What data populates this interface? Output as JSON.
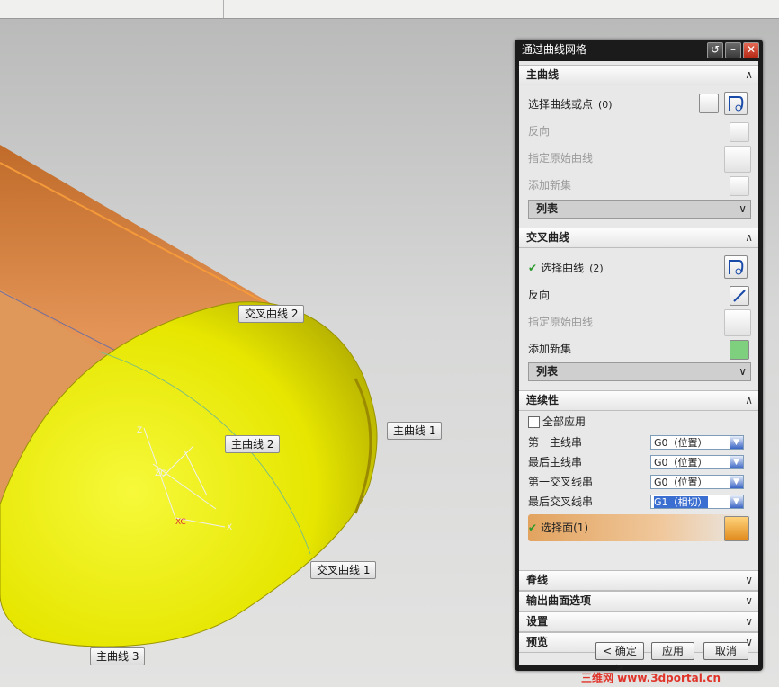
{
  "viewport": {
    "callouts": {
      "cross2": "交叉曲线 2",
      "primary1": "主曲线 1",
      "primary2": "主曲线 2",
      "cross1": "交叉曲线 1",
      "primary3": "主曲线 3"
    },
    "axes": {
      "zc": "ZC",
      "z": "Z",
      "xc": "XC",
      "x": "X"
    }
  },
  "dialog": {
    "title": "通过曲线网格",
    "primary_section": {
      "label": "主曲线",
      "select_label": "选择曲线或点",
      "select_count": "(0)",
      "reverse_label": "反向",
      "specify_origin_label": "指定原始曲线",
      "add_set_label": "添加新集",
      "list_label": "列表"
    },
    "cross_section": {
      "label": "交叉曲线",
      "select_label": "选择曲线",
      "select_count": "(2)",
      "reverse_label": "反向",
      "specify_origin_label": "指定原始曲线",
      "add_set_label": "添加新集",
      "list_label": "列表"
    },
    "continuity": {
      "label": "连续性",
      "apply_all_label": "全部应用",
      "rows": [
        {
          "label": "第一主线串",
          "value": "G0（位置）"
        },
        {
          "label": "最后主线串",
          "value": "G0（位置）"
        },
        {
          "label": "第一交叉线串",
          "value": "G0（位置）"
        },
        {
          "label": "最后交叉线串",
          "value": "G1（相切）"
        }
      ],
      "face_label": "选择面",
      "face_count": "(1)"
    },
    "collapsed": [
      "脊线",
      "输出曲面选项",
      "设置",
      "预览"
    ],
    "buttons": {
      "ok": "< 确定 >",
      "apply": "应用",
      "cancel": "取消"
    }
  },
  "watermark": "三维网 www.3dportal.cn",
  "colors": {
    "surface_yellow": "#e6e600",
    "surface_orange": "#d98a44",
    "dialog_dark": "#1b1b1b"
  }
}
